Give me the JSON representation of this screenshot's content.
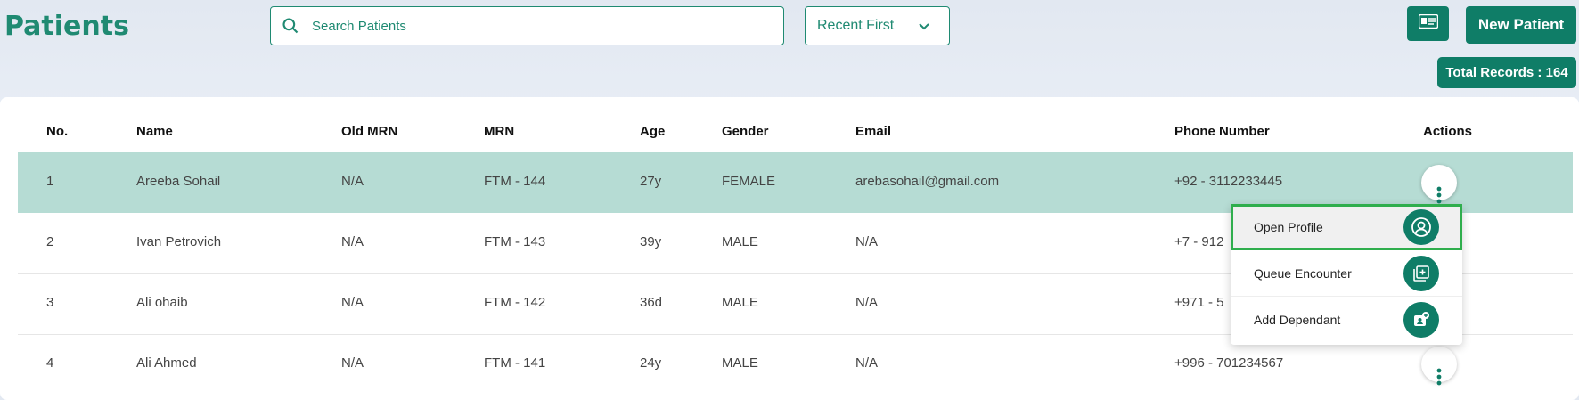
{
  "header": {
    "title": "Patients",
    "search_placeholder": "Search Patients",
    "sort_value": "Recent First",
    "new_patient_label": "New Patient",
    "total_records": "Total Records : 164"
  },
  "table": {
    "columns": [
      "No.",
      "Name",
      "Old MRN",
      "MRN",
      "Age",
      "Gender",
      "Email",
      "Phone Number",
      "Actions"
    ],
    "rows": [
      {
        "no": "1",
        "name": "Areeba Sohail",
        "old_mrn": "N/A",
        "mrn": "FTM - 144",
        "age": "27y",
        "gender": "FEMALE",
        "email": "arebasohail@gmail.com",
        "phone": "+92 - 3112233445"
      },
      {
        "no": "2",
        "name": "Ivan Petrovich",
        "old_mrn": "N/A",
        "mrn": "FTM - 143",
        "age": "39y",
        "gender": "MALE",
        "email": "N/A",
        "phone": "+7 - 912"
      },
      {
        "no": "3",
        "name": "Ali ohaib",
        "old_mrn": "N/A",
        "mrn": "FTM - 142",
        "age": "36d",
        "gender": "MALE",
        "email": "N/A",
        "phone": "+971 - 5"
      },
      {
        "no": "4",
        "name": "Ali Ahmed",
        "old_mrn": "N/A",
        "mrn": "FTM - 141",
        "age": "24y",
        "gender": "MALE",
        "email": "N/A",
        "phone": "+996 - 701234567"
      }
    ]
  },
  "menu": {
    "items": [
      {
        "label": "Open Profile",
        "icon": "user-circle-icon"
      },
      {
        "label": "Queue Encounter",
        "icon": "queue-add-icon"
      },
      {
        "label": "Add Dependant",
        "icon": "add-dependant-icon"
      }
    ]
  },
  "colors": {
    "brand": "#0f7d67",
    "selected_row": "#b6dcd4",
    "highlight": "#2fae4d"
  }
}
